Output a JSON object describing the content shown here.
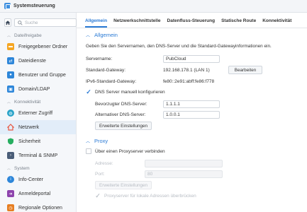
{
  "window": {
    "title": "Systemsteuerung"
  },
  "sidebar": {
    "search_placeholder": "Suche",
    "sections": [
      {
        "label": "Dateifreigabe"
      },
      {
        "label": "Konnektivität"
      },
      {
        "label": "System"
      }
    ],
    "items": [
      {
        "label": "Freigegebener Ordner",
        "icon": "folder-icon",
        "color": "#f5a623"
      },
      {
        "label": "Dateidienste",
        "icon": "file-services-icon",
        "color": "#2d86d9"
      },
      {
        "label": "Benutzer und Gruppe",
        "icon": "users-icon",
        "color": "#2d86d9"
      },
      {
        "label": "Domain/LDAP",
        "icon": "domain-icon",
        "color": "#2d86d9"
      },
      {
        "label": "Externer Zugriff",
        "icon": "globe-icon",
        "color": "#2aa3c8"
      },
      {
        "label": "Netzwerk",
        "icon": "house-network-icon",
        "color": "#e8553f"
      },
      {
        "label": "Sicherheit",
        "icon": "shield-icon",
        "color": "#27ae60"
      },
      {
        "label": "Terminal & SNMP",
        "icon": "terminal-icon",
        "color": "#4a5d78"
      },
      {
        "label": "Info-Center",
        "icon": "info-icon",
        "color": "#2d86d9"
      },
      {
        "label": "Anmeldeportal",
        "icon": "login-portal-icon",
        "color": "#8e44ad"
      },
      {
        "label": "Regionale Optionen",
        "icon": "region-icon",
        "color": "#e67e22"
      }
    ]
  },
  "tabs": [
    "Allgemein",
    "Netzwerkschnittstelle",
    "Datenfluss-Steuerung",
    "Statische Route",
    "Konnektivität"
  ],
  "general": {
    "heading": "Allgemein",
    "description": "Geben Sie den Servernamen, den DNS-Server und die Standard-Gatewayinformationen ein.",
    "server_name_label": "Servername:",
    "server_name_value": "PubCloud",
    "gateway_label": "Standard-Gateway:",
    "gateway_value": "192.168.178.1 (LAN 1)",
    "edit_button": "Bearbeiten",
    "ipv6_label": "IPv6-Standard-Gateway:",
    "ipv6_value": "fe80::2e91:abff:fe86:f778",
    "dns_manual_label": "DNS Server manuell konfigurieren",
    "preferred_dns_label": "Bevorzugter DNS-Server:",
    "preferred_dns_value": "1.1.1.1",
    "alternate_dns_label": "Alternativer DNS-Server:",
    "alternate_dns_value": "1.0.0.1",
    "advanced_button": "Erweiterte Einstellungen"
  },
  "proxy": {
    "heading": "Proxy",
    "connect_label": "Über einen Proxyserver verbinden",
    "address_label": "Adresse:",
    "address_value": "",
    "port_label": "Port:",
    "port_value": "80",
    "advanced_button": "Erweiterte Einstellungen",
    "bypass_label": "Proxyserver für lokale Adressen überbrücken"
  },
  "colors": {
    "accent": "#2a7ad5",
    "active_item_bg": "#e2edf9"
  }
}
